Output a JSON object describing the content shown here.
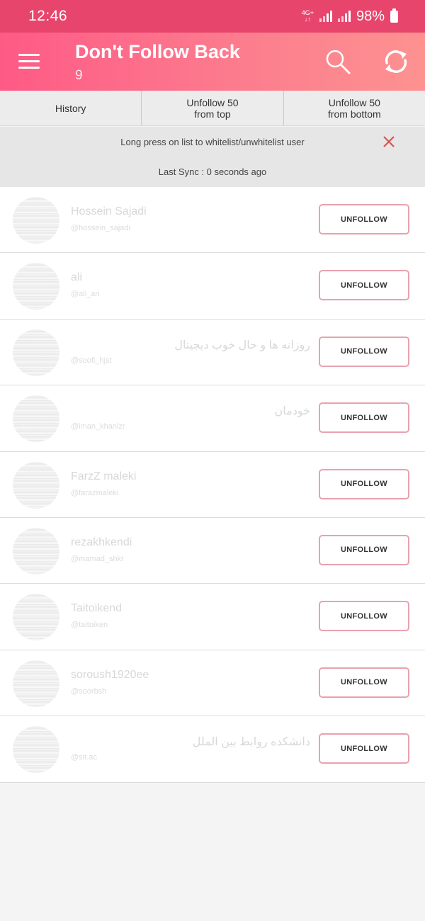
{
  "status_bar": {
    "time": "12:46",
    "network": "4G+",
    "battery": "98%"
  },
  "app_bar": {
    "title": "Don't Follow Back",
    "count": "9"
  },
  "tabs": [
    {
      "line1": "History",
      "line2": ""
    },
    {
      "line1": "Unfollow 50",
      "line2": "from top"
    },
    {
      "line1": "Unfollow 50",
      "line2": "from bottom"
    }
  ],
  "info": {
    "hint": "Long press on list to whitelist/unwhitelist user",
    "last_sync": "Last Sync : 0 seconds ago"
  },
  "users": [
    {
      "name": "Hossein Sajadi",
      "handle": "@hossein_sajadi",
      "rtl": false
    },
    {
      "name": "ali",
      "handle": "@ali_ari",
      "rtl": false
    },
    {
      "name": "روزانه ها و حال خوب دیجیتال",
      "handle": "@soofi_hjst",
      "rtl": true
    },
    {
      "name": "خودمان",
      "handle": "@iman_khanlzr",
      "rtl": true
    },
    {
      "name": "FarzZ maleki",
      "handle": "@farazmaleki",
      "rtl": false
    },
    {
      "name": "rezakhkendi",
      "handle": "@mamad_shkr",
      "rtl": false
    },
    {
      "name": "Taitoikend",
      "handle": "@taitoiken",
      "rtl": false
    },
    {
      "name": "soroush1920ee",
      "handle": "@soorbsh",
      "rtl": false
    },
    {
      "name": "دانشکده روابط بین الملل",
      "handle": "@sir.ac",
      "rtl": true
    }
  ],
  "unfollow_label": "UNFOLLOW",
  "colors": {
    "status_bar": "#e8456d",
    "app_bar_start": "#fe5a85",
    "app_bar_end": "#fd9290",
    "button_border": "#e9a2ae",
    "close_x": "#d9534f"
  },
  "icons": {
    "menu": "menu-icon",
    "search": "search-icon",
    "sync": "sync-icon",
    "close": "close-icon"
  }
}
